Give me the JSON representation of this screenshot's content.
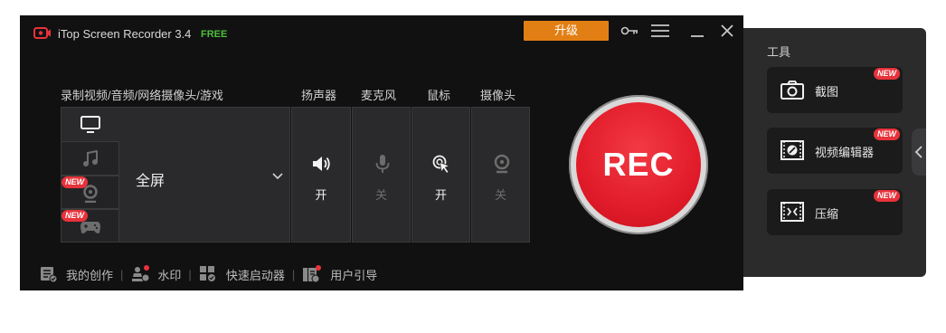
{
  "window": {
    "title": "iTop Screen Recorder 3.4",
    "edition": "FREE",
    "upgrade_label": "升级",
    "accent": "#e27f14"
  },
  "sections": {
    "record": "录制视频/音频/网络摄像头/游戏",
    "speaker": "扬声器",
    "mic": "麦克风",
    "mouse": "鼠标",
    "camera": "摄像头"
  },
  "modes": {
    "selected": "全屏",
    "webcam_badge": "NEW",
    "game_badge": "NEW"
  },
  "tools": {
    "speaker_state": "开",
    "mic_state": "关",
    "mouse_state": "开",
    "camera_state": "关"
  },
  "rec": {
    "label": "REC",
    "color": "#e8202e"
  },
  "bottom": {
    "my_creation": "我的创作",
    "watermark": "水印",
    "quick_launcher": "快速启动器",
    "user_guide": "用户引导"
  },
  "side": {
    "title": "工具",
    "items": [
      {
        "label": "截图",
        "badge": "NEW",
        "icon": "camera-icon"
      },
      {
        "label": "视频编辑器",
        "badge": "NEW",
        "icon": "video-edit-icon"
      },
      {
        "label": "压缩",
        "badge": "NEW",
        "icon": "compress-icon"
      }
    ]
  }
}
